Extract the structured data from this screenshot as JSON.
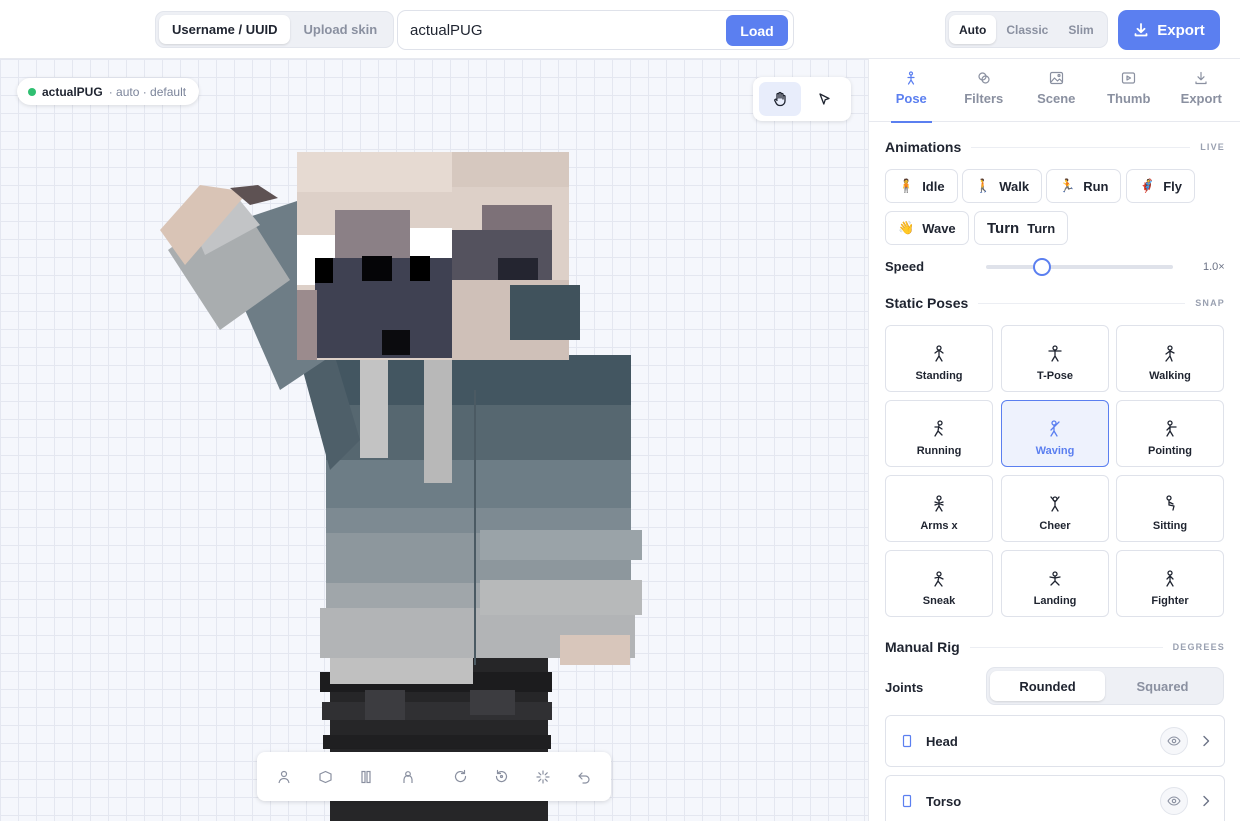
{
  "topbar": {
    "source_tabs": [
      {
        "label": "Username / UUID",
        "active": true
      },
      {
        "label": "Upload skin",
        "active": false
      }
    ],
    "username_value": "actualPUG",
    "load_label": "Load",
    "model_tabs": [
      {
        "label": "Auto",
        "active": true
      },
      {
        "label": "Classic",
        "active": false
      },
      {
        "label": "Slim",
        "active": false
      }
    ],
    "export_label": "Export"
  },
  "viewport": {
    "skin_name": "actualPUG",
    "skin_meta": "· auto · default",
    "status_color": "#2fbf71",
    "mode_tools": [
      "hand-icon",
      "cursor-icon"
    ],
    "bottom_tools": [
      "person-icon",
      "box-icon",
      "columns-icon",
      "person-outline-icon",
      "rotate-icon",
      "reset-icon",
      "sparkle-icon",
      "undo-icon"
    ]
  },
  "panel": {
    "tabs": [
      {
        "label": "Pose",
        "icon": "figure-icon",
        "active": true
      },
      {
        "label": "Filters",
        "icon": "filters-icon",
        "active": false
      },
      {
        "label": "Scene",
        "icon": "image-icon",
        "active": false
      },
      {
        "label": "Thumb",
        "icon": "play-icon",
        "active": false
      },
      {
        "label": "Export",
        "icon": "download-icon",
        "active": false
      }
    ],
    "animations": {
      "title": "Animations",
      "tag": "LIVE",
      "items": [
        {
          "icon": "🧍",
          "label": "Idle"
        },
        {
          "icon": "🚶",
          "label": "Walk"
        },
        {
          "icon": "🏃",
          "label": "Run"
        },
        {
          "icon": "🦸",
          "label": "Fly"
        },
        {
          "icon": "👋",
          "label": "Wave"
        },
        {
          "icon": "Turn",
          "label": "Turn"
        }
      ],
      "speed_label": "Speed",
      "speed_value": "1.0×",
      "speed_fraction": 0.3
    },
    "static_poses": {
      "title": "Static Poses",
      "tag": "SNAP",
      "items": [
        {
          "label": "Standing",
          "active": false
        },
        {
          "label": "T-Pose",
          "active": false
        },
        {
          "label": "Walking",
          "active": false
        },
        {
          "label": "Running",
          "active": false
        },
        {
          "label": "Waving",
          "active": true
        },
        {
          "label": "Pointing",
          "active": false
        },
        {
          "label": "Arms x",
          "active": false
        },
        {
          "label": "Cheer",
          "active": false
        },
        {
          "label": "Sitting",
          "active": false
        },
        {
          "label": "Sneak",
          "active": false
        },
        {
          "label": "Landing",
          "active": false
        },
        {
          "label": "Fighter",
          "active": false
        }
      ]
    },
    "manual_rig": {
      "title": "Manual Rig",
      "tag": "DEGREES",
      "joints_label": "Joints",
      "joint_styles": [
        {
          "label": "Rounded",
          "active": true
        },
        {
          "label": "Squared",
          "active": false
        }
      ],
      "parts": [
        {
          "label": "Head"
        },
        {
          "label": "Torso"
        }
      ]
    }
  },
  "colors": {
    "accent": "#5b7ff0",
    "text": "#1f2430",
    "muted": "#8a90a0"
  }
}
